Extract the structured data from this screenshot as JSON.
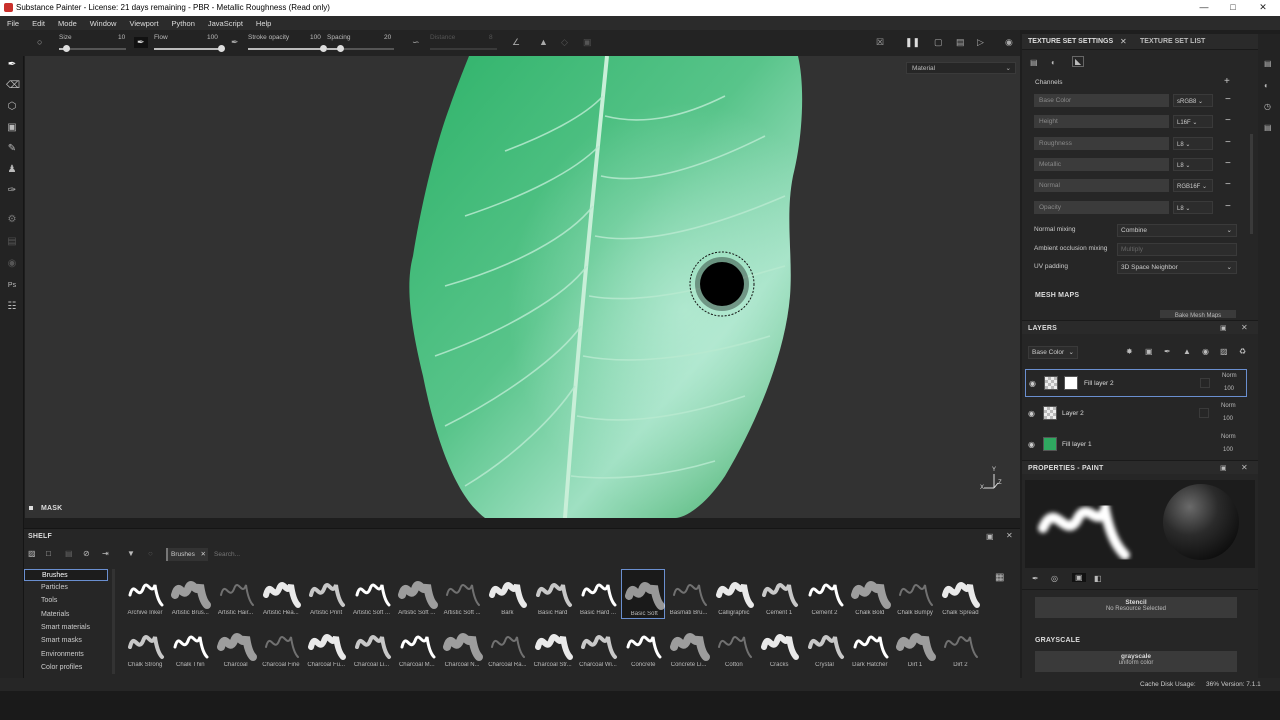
{
  "window": {
    "title": "Substance Painter - License: 21 days remaining - PBR - Metallic Roughness (Read only)"
  },
  "menu": [
    "File",
    "Edit",
    "Mode",
    "Window",
    "Viewport",
    "Python",
    "JavaScript",
    "Help"
  ],
  "toolbar": {
    "size_label": "Size",
    "size_value": "10",
    "size_level": 0.1,
    "flow_label": "Flow",
    "flow_value": "100",
    "flow_level": 1.0,
    "opacity_label": "Stroke opacity",
    "opacity_value": "100",
    "opacity_level": 1.0,
    "spacing_label": "Spacing",
    "spacing_value": "20",
    "spacing_level": 0.2,
    "distance_label": "Distance",
    "distance_value": "8"
  },
  "viewport": {
    "material_dropdown": "Material",
    "mask_label": "MASK",
    "axis_x": "X",
    "axis_y": "Y",
    "axis_z": "Z"
  },
  "shelf": {
    "title": "SHELF",
    "filter_tag": "Brushes",
    "search_placeholder": "Search...",
    "categories": [
      "Brushes",
      "Particles",
      "Tools",
      "Materials",
      "Smart materials",
      "Smart masks",
      "Environments",
      "Color profiles"
    ],
    "selected_category": "Brushes",
    "brushes_row1": [
      "Archive Inker",
      "Artistic Brus...",
      "Artistic Hair...",
      "Artistic Hea...",
      "Artistic Print",
      "Artistic Soft ...",
      "Artistic Soft ...",
      "Artistic Soft ...",
      "Bark",
      "Basic Hard",
      "Basic Hard ...",
      "Basic Soft",
      "Basmati Bru...",
      "Calligraphic",
      "Cement 1",
      "Cement 2",
      "Chalk Bold",
      "Chalk Bumpy",
      "Chalk Spread"
    ],
    "brushes_row2": [
      "Chalk Strong",
      "Chalk Thin",
      "Charcoal",
      "Charcoal Fine",
      "Charcoal Fu...",
      "Charcoal Li...",
      "Charcoal M...",
      "Charcoal N...",
      "Charcoal Ra...",
      "Charcoal Str...",
      "Charcoal Wi...",
      "Concrete",
      "Concrete Li...",
      "Cotton",
      "Cracks",
      "Crystal",
      "Dark Hatcher",
      "Dirt 1",
      "Dirt 2"
    ],
    "selected_brush": "Basic Soft"
  },
  "texture_set": {
    "tab_active": "TEXTURE SET SETTINGS",
    "tab_other": "TEXTURE SET LIST",
    "channels_label": "Channels",
    "channels": [
      {
        "name": "Base Color",
        "format": "sRGB8"
      },
      {
        "name": "Height",
        "format": "L16F"
      },
      {
        "name": "Roughness",
        "format": "L8"
      },
      {
        "name": "Metallic",
        "format": "L8"
      },
      {
        "name": "Normal",
        "format": "RGB16F"
      },
      {
        "name": "Opacity",
        "format": "L8"
      }
    ],
    "normal_mixing_label": "Normal mixing",
    "normal_mixing": "Combine",
    "ao_mixing_label": "Ambient occlusion mixing",
    "ao_mixing": "Multiply",
    "uv_padding_label": "UV padding",
    "uv_padding": "3D Space Neighbor",
    "mesh_maps_label": "MESH MAPS",
    "bake_button": "Bake Mesh Maps"
  },
  "layers": {
    "title": "LAYERS",
    "channel_dropdown": "Base Color",
    "items": [
      {
        "name": "Fill layer 2",
        "blend": "Norm",
        "opacity": "100"
      },
      {
        "name": "Layer 2",
        "blend": "Norm",
        "opacity": "100"
      },
      {
        "name": "Fill layer 1",
        "blend": "Norm",
        "opacity": "100"
      }
    ]
  },
  "properties": {
    "title": "PROPERTIES - PAINT",
    "stencil_label": "Stencil",
    "stencil_value": "No Resource Selected",
    "grayscale_label": "GRAYSCALE",
    "grayscale_name": "grayscale",
    "grayscale_sub": "uniform color"
  },
  "status": {
    "cache_label": "Cache Disk Usage:",
    "cache_value": "36%",
    "version": "Version: 7.1.1"
  },
  "colors": {
    "accent": "#6a8fd0",
    "leaf": "#3fb26a",
    "panel": "#262626"
  }
}
